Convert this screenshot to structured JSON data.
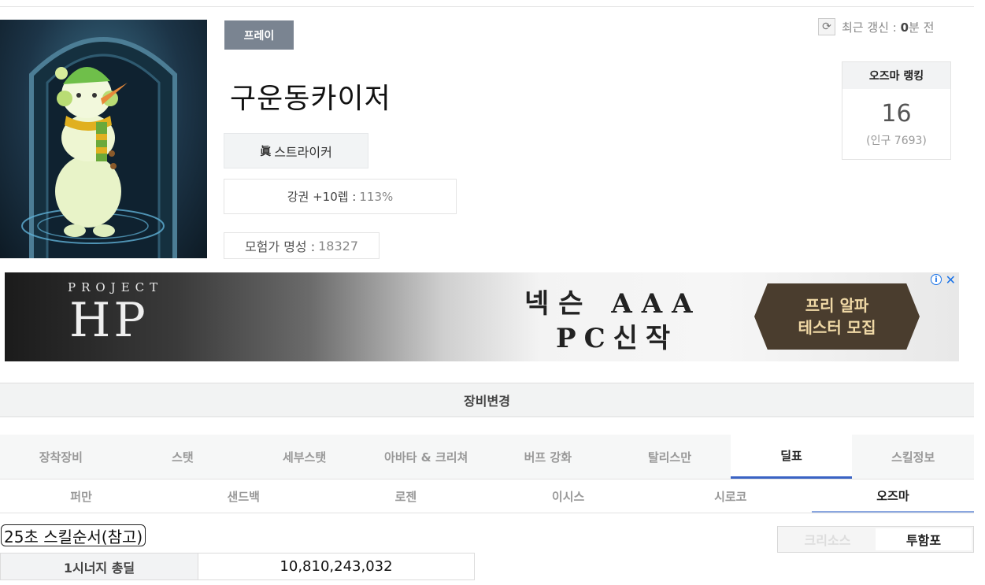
{
  "profile": {
    "server": "프레이",
    "name": "구운동카이저",
    "job_mark": "眞",
    "job": "스트라이커",
    "buff_label": "강권 +10렙 :",
    "buff_value": "113%",
    "fame_label": "모험가 명성 :",
    "fame_value": "18327"
  },
  "refresh": {
    "prefix": "최근 갱신 :",
    "value": "0",
    "suffix": "분 전",
    "icon": "refresh-icon"
  },
  "ranking": {
    "title": "오즈마 랭킹",
    "value": "16",
    "popularity": "(인구 7693)"
  },
  "ad": {
    "project": "PROJECT",
    "logo": "HP",
    "headline1": "넥슨 AAA",
    "headline2": "PC신작",
    "cta_line1": "프리 알파",
    "cta_line2": "테스터 모집",
    "info": "i",
    "close": "✕"
  },
  "equip_change": "장비변경",
  "main_tabs": [
    "장착장비",
    "스탯",
    "세부스탯",
    "아바타 & 크리쳐",
    "버프 강화",
    "탈리스만",
    "딜표",
    "스킬정보"
  ],
  "main_tabs_active": 6,
  "raid_tabs": [
    "퍼만",
    "샌드백",
    "로젠",
    "이시스",
    "시로코",
    "오즈마"
  ],
  "raid_tabs_active": 5,
  "skill_order": "25초 스킬순서(참고)",
  "toggle": [
    "크리소스",
    "투함포"
  ],
  "toggle_active": 1,
  "total": {
    "label": "1시너지 총딜",
    "value": "10,810,243,032"
  },
  "colors": {
    "server_badge": "#7a8491",
    "active_tab_underline": "#3a63c4"
  }
}
